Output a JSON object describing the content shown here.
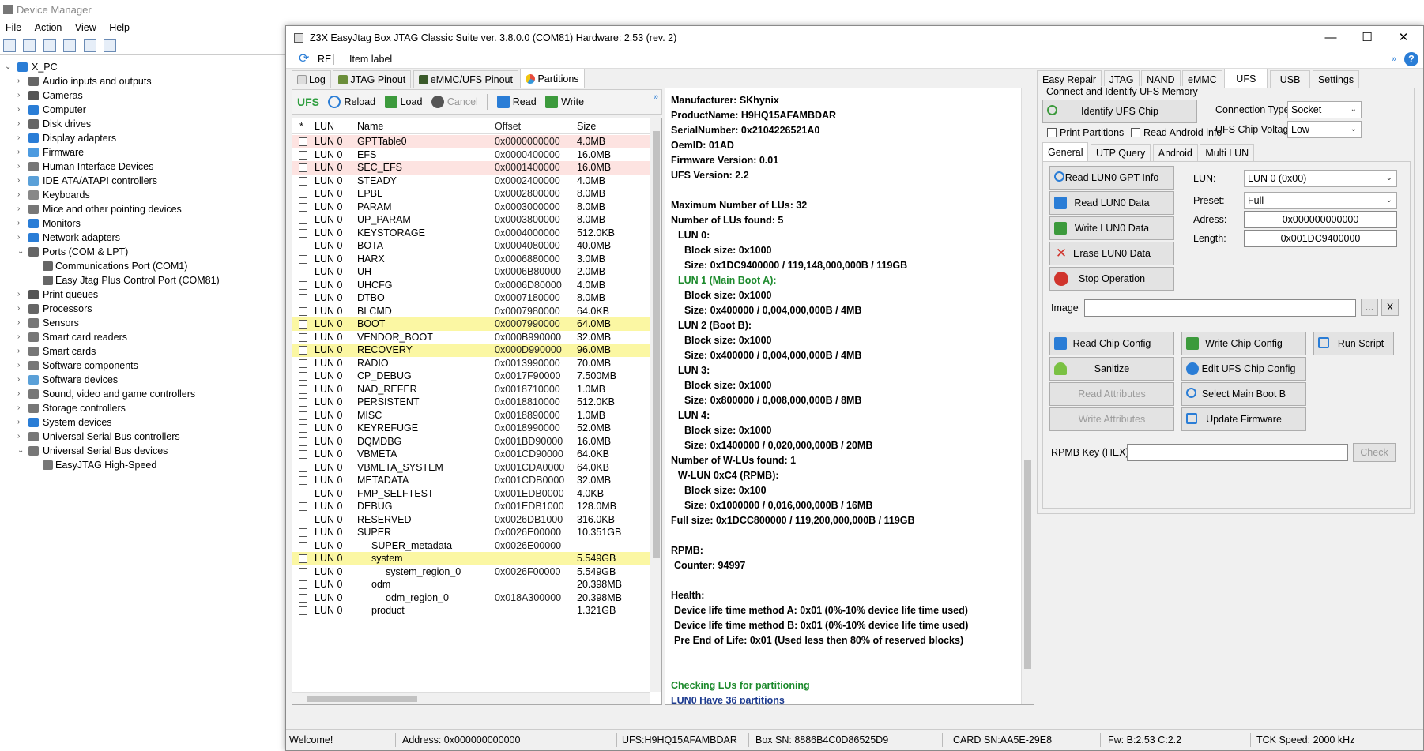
{
  "device_manager": {
    "title": "Device Manager",
    "menu": [
      "File",
      "Action",
      "View",
      "Help"
    ],
    "root": "X_PC",
    "tree": [
      {
        "label": "Audio inputs and outputs",
        "icon": "speaker-icon",
        "color": "#666666",
        "level": 1,
        "arrow": "›"
      },
      {
        "label": "Cameras",
        "icon": "camera-icon",
        "color": "#555555",
        "level": 1,
        "arrow": "›"
      },
      {
        "label": "Computer",
        "icon": "computer-icon",
        "color": "#2a7dd6",
        "level": 1,
        "arrow": "›"
      },
      {
        "label": "Disk drives",
        "icon": "disk-icon",
        "color": "#666666",
        "level": 1,
        "arrow": "›"
      },
      {
        "label": "Display adapters",
        "icon": "display-icon",
        "color": "#2a7dd6",
        "level": 1,
        "arrow": "›"
      },
      {
        "label": "Firmware",
        "icon": "firmware-icon",
        "color": "#4d9be0",
        "level": 1,
        "arrow": "›"
      },
      {
        "label": "Human Interface Devices",
        "icon": "hid-icon",
        "color": "#777777",
        "level": 1,
        "arrow": "›"
      },
      {
        "label": "IDE ATA/ATAPI controllers",
        "icon": "ide-icon",
        "color": "#5aa0d8",
        "level": 1,
        "arrow": "›"
      },
      {
        "label": "Keyboards",
        "icon": "keyboard-icon",
        "color": "#888888",
        "level": 1,
        "arrow": "›"
      },
      {
        "label": "Mice and other pointing devices",
        "icon": "mouse-icon",
        "color": "#777777",
        "level": 1,
        "arrow": "›"
      },
      {
        "label": "Monitors",
        "icon": "monitor-icon",
        "color": "#2a7dd6",
        "level": 1,
        "arrow": "›"
      },
      {
        "label": "Network adapters",
        "icon": "network-icon",
        "color": "#2a7dd6",
        "level": 1,
        "arrow": "›"
      },
      {
        "label": "Ports (COM & LPT)",
        "icon": "port-icon",
        "color": "#666666",
        "level": 1,
        "arrow": "⌄"
      },
      {
        "label": "Communications Port (COM1)",
        "icon": "port-icon",
        "color": "#666666",
        "level": 2,
        "arrow": ""
      },
      {
        "label": "Easy Jtag Plus Control Port (COM81)",
        "icon": "port-icon",
        "color": "#666666",
        "level": 2,
        "arrow": ""
      },
      {
        "label": "Print queues",
        "icon": "printer-icon",
        "color": "#555555",
        "level": 1,
        "arrow": "›"
      },
      {
        "label": "Processors",
        "icon": "processor-icon",
        "color": "#666666",
        "level": 1,
        "arrow": "›"
      },
      {
        "label": "Sensors",
        "icon": "sensor-icon",
        "color": "#777777",
        "level": 1,
        "arrow": "›"
      },
      {
        "label": "Smart card readers",
        "icon": "smartcard-reader-icon",
        "color": "#777777",
        "level": 1,
        "arrow": "›"
      },
      {
        "label": "Smart cards",
        "icon": "smartcard-icon",
        "color": "#777777",
        "level": 1,
        "arrow": "›"
      },
      {
        "label": "Software components",
        "icon": "software-component-icon",
        "color": "#777777",
        "level": 1,
        "arrow": "›"
      },
      {
        "label": "Software devices",
        "icon": "software-device-icon",
        "color": "#5aa0d8",
        "level": 1,
        "arrow": "›"
      },
      {
        "label": "Sound, video and game controllers",
        "icon": "sound-icon",
        "color": "#777777",
        "level": 1,
        "arrow": "›"
      },
      {
        "label": "Storage controllers",
        "icon": "storage-icon",
        "color": "#777777",
        "level": 1,
        "arrow": "›"
      },
      {
        "label": "System devices",
        "icon": "system-icon",
        "color": "#2a7dd6",
        "level": 1,
        "arrow": "›"
      },
      {
        "label": "Universal Serial Bus controllers",
        "icon": "usb-icon",
        "color": "#777777",
        "level": 1,
        "arrow": "›"
      },
      {
        "label": "Universal Serial Bus devices",
        "icon": "usb-icon",
        "color": "#777777",
        "level": 1,
        "arrow": "⌄"
      },
      {
        "label": "EasyJTAG High-Speed",
        "icon": "usb-icon",
        "color": "#777777",
        "level": 2,
        "arrow": ""
      }
    ]
  },
  "app": {
    "title": "Z3X EasyJtag Box JTAG Classic Suite ver. 3.8.0.0 (COM81) Hardware: 2.53 (rev. 2)",
    "bar2": {
      "re_label": "RE",
      "item_label": "Item label"
    },
    "left_tabs": [
      "Log",
      "JTAG Pinout",
      "eMMC/UFS Pinout",
      "Partitions"
    ],
    "ufs_toolbar": {
      "ufs": "UFS",
      "reload": "Reload",
      "load": "Load",
      "cancel": "Cancel",
      "read": "Read",
      "write": "Write"
    },
    "partition_headers": [
      "*",
      "LUN",
      "Name",
      "Offset",
      "Size"
    ],
    "partitions": [
      {
        "lun": "LUN 0",
        "name": "GPTTable0",
        "offset": "0x0000000000",
        "size": "4.0MB",
        "hl": "red",
        "indent": 0
      },
      {
        "lun": "LUN 0",
        "name": "EFS",
        "offset": "0x0000400000",
        "size": "16.0MB",
        "hl": "",
        "indent": 0
      },
      {
        "lun": "LUN 0",
        "name": "SEC_EFS",
        "offset": "0x0001400000",
        "size": "16.0MB",
        "hl": "red",
        "indent": 0
      },
      {
        "lun": "LUN 0",
        "name": "STEADY",
        "offset": "0x0002400000",
        "size": "4.0MB",
        "hl": "",
        "indent": 0
      },
      {
        "lun": "LUN 0",
        "name": "EPBL",
        "offset": "0x0002800000",
        "size": "8.0MB",
        "hl": "",
        "indent": 0
      },
      {
        "lun": "LUN 0",
        "name": "PARAM",
        "offset": "0x0003000000",
        "size": "8.0MB",
        "hl": "",
        "indent": 0
      },
      {
        "lun": "LUN 0",
        "name": "UP_PARAM",
        "offset": "0x0003800000",
        "size": "8.0MB",
        "hl": "",
        "indent": 0
      },
      {
        "lun": "LUN 0",
        "name": "KEYSTORAGE",
        "offset": "0x0004000000",
        "size": "512.0KB",
        "hl": "",
        "indent": 0
      },
      {
        "lun": "LUN 0",
        "name": "BOTA",
        "offset": "0x0004080000",
        "size": "40.0MB",
        "hl": "",
        "indent": 0
      },
      {
        "lun": "LUN 0",
        "name": "HARX",
        "offset": "0x0006880000",
        "size": "3.0MB",
        "hl": "",
        "indent": 0
      },
      {
        "lun": "LUN 0",
        "name": "UH",
        "offset": "0x0006B80000",
        "size": "2.0MB",
        "hl": "",
        "indent": 0
      },
      {
        "lun": "LUN 0",
        "name": "UHCFG",
        "offset": "0x0006D80000",
        "size": "4.0MB",
        "hl": "",
        "indent": 0
      },
      {
        "lun": "LUN 0",
        "name": "DTBO",
        "offset": "0x0007180000",
        "size": "8.0MB",
        "hl": "",
        "indent": 0
      },
      {
        "lun": "LUN 0",
        "name": "BLCMD",
        "offset": "0x0007980000",
        "size": "64.0KB",
        "hl": "",
        "indent": 0
      },
      {
        "lun": "LUN 0",
        "name": "BOOT",
        "offset": "0x0007990000",
        "size": "64.0MB",
        "hl": "yel",
        "indent": 0
      },
      {
        "lun": "LUN 0",
        "name": "VENDOR_BOOT",
        "offset": "0x000B990000",
        "size": "32.0MB",
        "hl": "",
        "indent": 0
      },
      {
        "lun": "LUN 0",
        "name": "RECOVERY",
        "offset": "0x000D990000",
        "size": "96.0MB",
        "hl": "yel",
        "indent": 0
      },
      {
        "lun": "LUN 0",
        "name": "RADIO",
        "offset": "0x0013990000",
        "size": "70.0MB",
        "hl": "",
        "indent": 0
      },
      {
        "lun": "LUN 0",
        "name": "CP_DEBUG",
        "offset": "0x0017F90000",
        "size": "7.500MB",
        "hl": "",
        "indent": 0
      },
      {
        "lun": "LUN 0",
        "name": "NAD_REFER",
        "offset": "0x0018710000",
        "size": "1.0MB",
        "hl": "",
        "indent": 0
      },
      {
        "lun": "LUN 0",
        "name": "PERSISTENT",
        "offset": "0x0018810000",
        "size": "512.0KB",
        "hl": "",
        "indent": 0
      },
      {
        "lun": "LUN 0",
        "name": "MISC",
        "offset": "0x0018890000",
        "size": "1.0MB",
        "hl": "",
        "indent": 0
      },
      {
        "lun": "LUN 0",
        "name": "KEYREFUGE",
        "offset": "0x0018990000",
        "size": "52.0MB",
        "hl": "",
        "indent": 0
      },
      {
        "lun": "LUN 0",
        "name": "DQMDBG",
        "offset": "0x001BD90000",
        "size": "16.0MB",
        "hl": "",
        "indent": 0
      },
      {
        "lun": "LUN 0",
        "name": "VBMETA",
        "offset": "0x001CD90000",
        "size": "64.0KB",
        "hl": "",
        "indent": 0
      },
      {
        "lun": "LUN 0",
        "name": "VBMETA_SYSTEM",
        "offset": "0x001CDA0000",
        "size": "64.0KB",
        "hl": "",
        "indent": 0
      },
      {
        "lun": "LUN 0",
        "name": "METADATA",
        "offset": "0x001CDB0000",
        "size": "32.0MB",
        "hl": "",
        "indent": 0
      },
      {
        "lun": "LUN 0",
        "name": "FMP_SELFTEST",
        "offset": "0x001EDB0000",
        "size": "4.0KB",
        "hl": "",
        "indent": 0
      },
      {
        "lun": "LUN 0",
        "name": "DEBUG",
        "offset": "0x001EDB1000",
        "size": "128.0MB",
        "hl": "",
        "indent": 0
      },
      {
        "lun": "LUN 0",
        "name": "RESERVED",
        "offset": "0x0026DB1000",
        "size": "316.0KB",
        "hl": "",
        "indent": 0
      },
      {
        "lun": "LUN 0",
        "name": "SUPER",
        "offset": "0x0026E00000",
        "size": "10.351GB",
        "hl": "",
        "indent": 0
      },
      {
        "lun": "LUN 0",
        "name": "SUPER_metadata",
        "offset": "0x0026E00000",
        "size": "",
        "hl": "",
        "indent": 1
      },
      {
        "lun": "LUN 0",
        "name": "system",
        "offset": "",
        "size": "5.549GB",
        "hl": "yel",
        "indent": 1
      },
      {
        "lun": "LUN 0",
        "name": "system_region_0",
        "offset": "0x0026F00000",
        "size": "5.549GB",
        "hl": "",
        "indent": 2
      },
      {
        "lun": "LUN 0",
        "name": "odm",
        "offset": "",
        "size": "20.398MB",
        "hl": "",
        "indent": 1
      },
      {
        "lun": "LUN 0",
        "name": "odm_region_0",
        "offset": "0x018A300000",
        "size": "20.398MB",
        "hl": "",
        "indent": 2
      },
      {
        "lun": "LUN 0",
        "name": "product",
        "offset": "",
        "size": "1.321GB",
        "hl": "",
        "indent": 1
      }
    ],
    "log": [
      {
        "text": "Manufacturer: SKhynix",
        "cls": "",
        "indent": 0
      },
      {
        "text": "ProductName: H9HQ15AFAMBDAR",
        "cls": "",
        "indent": 0
      },
      {
        "text": "SerialNumber: 0x2104226521A0",
        "cls": "",
        "indent": 0
      },
      {
        "text": "OemID: 01AD",
        "cls": "",
        "indent": 0
      },
      {
        "text": "Firmware Version: 0.01",
        "cls": "",
        "indent": 0
      },
      {
        "text": "UFS Version: 2.2",
        "cls": "",
        "indent": 0
      },
      {
        "text": "",
        "cls": "",
        "indent": 0
      },
      {
        "text": "Maximum Number of LUs: 32",
        "cls": "",
        "indent": 0
      },
      {
        "text": "Number of LUs found: 5",
        "cls": "",
        "indent": 0
      },
      {
        "text": "LUN 0:",
        "cls": "",
        "indent": 1
      },
      {
        "text": "Block size: 0x1000",
        "cls": "",
        "indent": 2
      },
      {
        "text": "Size: 0x1DC9400000 / 119,148,000,000B / 119GB",
        "cls": "",
        "indent": 2
      },
      {
        "text": "LUN 1 (Main Boot A):",
        "cls": "g",
        "indent": 1
      },
      {
        "text": "Block size: 0x1000",
        "cls": "",
        "indent": 2
      },
      {
        "text": "Size: 0x400000 / 0,004,000,000B / 4MB",
        "cls": "",
        "indent": 2
      },
      {
        "text": "LUN 2 (Boot B):",
        "cls": "",
        "indent": 1
      },
      {
        "text": "Block size: 0x1000",
        "cls": "",
        "indent": 2
      },
      {
        "text": "Size: 0x400000 / 0,004,000,000B / 4MB",
        "cls": "",
        "indent": 2
      },
      {
        "text": "LUN 3:",
        "cls": "",
        "indent": 1
      },
      {
        "text": "Block size: 0x1000",
        "cls": "",
        "indent": 2
      },
      {
        "text": "Size: 0x800000 / 0,008,000,000B / 8MB",
        "cls": "",
        "indent": 2
      },
      {
        "text": "LUN 4:",
        "cls": "",
        "indent": 1
      },
      {
        "text": "Block size: 0x1000",
        "cls": "",
        "indent": 2
      },
      {
        "text": "Size: 0x1400000 / 0,020,000,000B / 20MB",
        "cls": "",
        "indent": 2
      },
      {
        "text": "Number of W-LUs found: 1",
        "cls": "",
        "indent": 0
      },
      {
        "text": "W-LUN 0xC4 (RPMB):",
        "cls": "",
        "indent": 1
      },
      {
        "text": "Block size: 0x100",
        "cls": "",
        "indent": 2
      },
      {
        "text": "Size: 0x1000000 / 0,016,000,000B / 16MB",
        "cls": "",
        "indent": 2
      },
      {
        "text": "Full size: 0x1DCC800000 / 119,200,000,000B / 119GB",
        "cls": "",
        "indent": 0
      },
      {
        "text": "",
        "cls": "",
        "indent": 0
      },
      {
        "text": "RPMB:",
        "cls": "",
        "indent": 0
      },
      {
        "text": "Counter: 94997",
        "cls": "",
        "indent": 3
      },
      {
        "text": "",
        "cls": "",
        "indent": 0
      },
      {
        "text": "Health:",
        "cls": "",
        "indent": 0
      },
      {
        "text": "Device life time method A: 0x01 (0%-10% device life time used)",
        "cls": "",
        "indent": 3
      },
      {
        "text": "Device life time method B: 0x01 (0%-10% device life time used)",
        "cls": "",
        "indent": 3
      },
      {
        "text": "Pre End of Life: 0x01 (Used less then 80% of reserved blocks)",
        "cls": "",
        "indent": 3
      },
      {
        "text": "",
        "cls": "",
        "indent": 0
      },
      {
        "text": "",
        "cls": "",
        "indent": 0
      },
      {
        "text": "Checking LUs for partitioning",
        "cls": "g",
        "indent": 0
      },
      {
        "text": "LUN0 Have 36 partitions",
        "cls": "b",
        "indent": 0
      }
    ],
    "right_tabs": [
      "Easy Repair",
      "JTAG",
      "NAND",
      "eMMC",
      "UFS",
      "USB",
      "Settings"
    ],
    "ufs_panel": {
      "group_title": "Connect and Identify UFS Memory",
      "identify_btn": "Identify UFS Chip",
      "conn_type_label": "Connection Type:",
      "conn_type_value": "Socket",
      "print_partitions": "Print Partitions",
      "read_android_info": "Read Android info",
      "voltage_label": "UFS Chip Voltage :",
      "voltage_value": "Low",
      "sub_tabs": [
        "General",
        "UTP Query",
        "Android",
        "Multi LUN"
      ],
      "buttons": {
        "read_gpt": "Read LUN0 GPT Info",
        "read_data": "Read LUN0 Data",
        "write_data": "Write LUN0 Data",
        "erase_data": "Erase LUN0 Data",
        "stop": "Stop Operation",
        "read_cfg": "Read Chip Config",
        "write_cfg": "Write Chip Config",
        "run_script": "Run Script",
        "sanitize": "Sanitize",
        "edit_cfg": "Edit UFS Chip Config",
        "read_attr": "Read Attributes",
        "select_boot": "Select Main Boot B",
        "write_attr": "Write Attributes",
        "update_fw": "Update Firmware",
        "check": "Check",
        "browse": "...",
        "clear": "X"
      },
      "lun_label": "LUN:",
      "lun_value": "LUN 0 (0x00)",
      "preset_label": "Preset:",
      "preset_value": "Full",
      "address_label": "Adress:",
      "address_value": "0x000000000000",
      "length_label": "Length:",
      "length_value": "0x001DC9400000",
      "image_label": "Image",
      "image_value": "",
      "rpmb_label": "RPMB Key (HEX):",
      "rpmb_value": ""
    },
    "status": {
      "welcome": "Welcome!",
      "address": "Address: 0x000000000000",
      "ufs": "UFS:H9HQ15AFAMBDAR",
      "box_sn": "Box SN: 8886B4C0D86525D9",
      "card_sn": "CARD SN:AA5E-29E8",
      "fw": "Fw: B:2.53 C:2.2",
      "tck": "TCK Speed: 2000 kHz"
    }
  }
}
